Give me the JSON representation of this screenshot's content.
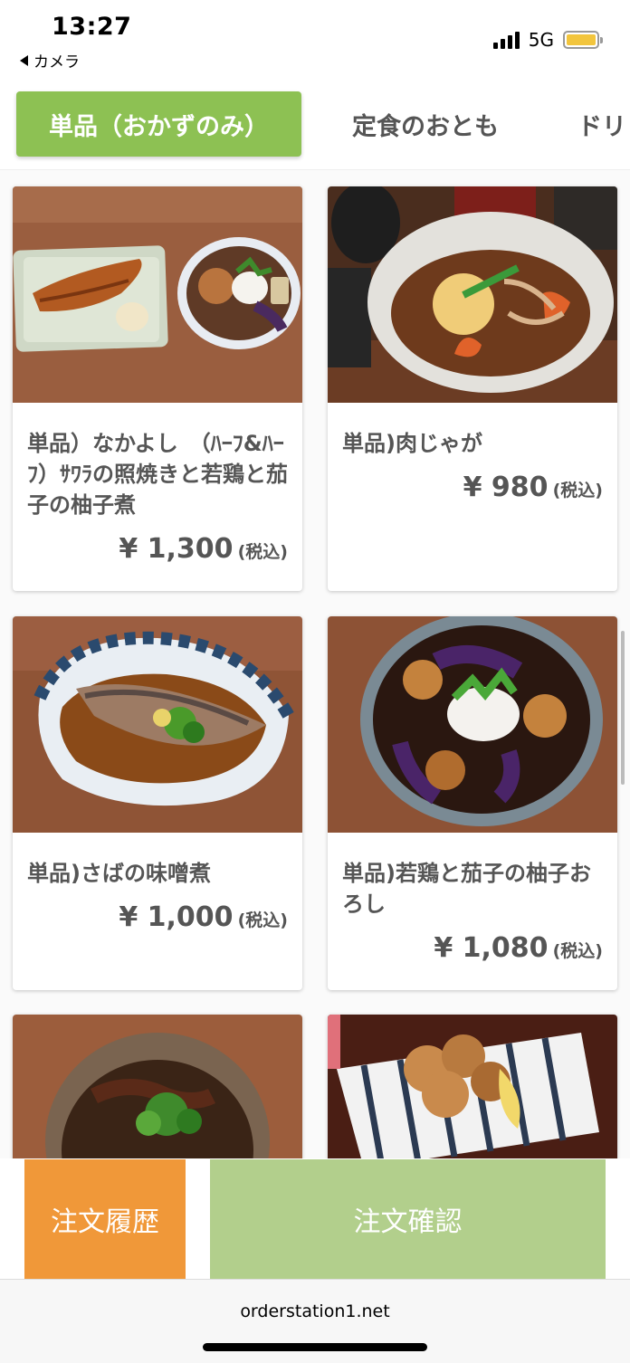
{
  "status": {
    "time": "13:27",
    "back_label": "カメラ",
    "network": "5G"
  },
  "tabs": [
    {
      "label": "単品（おかずのみ）",
      "active": true
    },
    {
      "label": "定食のおとも",
      "active": false
    },
    {
      "label": "ドリ",
      "active": false
    }
  ],
  "items": [
    {
      "name": "単品）なかよし　（ﾊｰﾌ&ﾊｰﾌ）ｻﾜﾗの照焼きと若鶏と茄子の柚子煮",
      "price": "¥ 1,300",
      "tax": "(税込)"
    },
    {
      "name": "単品)肉じゃが",
      "price": "¥ 980",
      "tax": "(税込)"
    },
    {
      "name": "単品)さばの味噌煮",
      "price": "¥ 1,000",
      "tax": "(税込)"
    },
    {
      "name": "単品)若鶏と茄子の柚子おろし",
      "price": "¥ 1,080",
      "tax": "(税込)"
    }
  ],
  "buttons": {
    "history": "注文履歴",
    "confirm": "注文確認"
  },
  "browser": {
    "url": "orderstation1.net"
  },
  "colors": {
    "tab_active": "#8dc153",
    "history_button": "#f09839",
    "confirm_button": "#b2cf8c"
  }
}
